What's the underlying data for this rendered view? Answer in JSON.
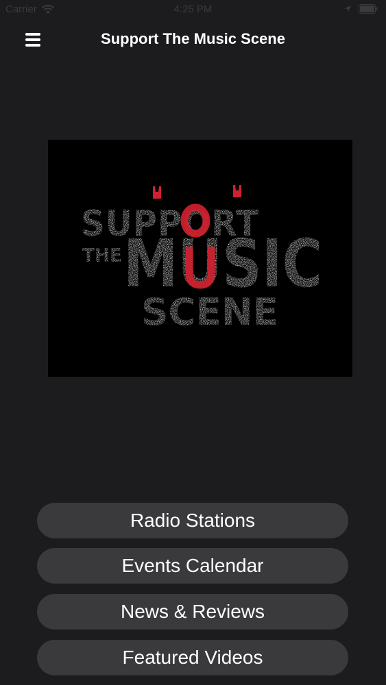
{
  "status_bar": {
    "carrier": "Carrier",
    "time": "4:25 PM"
  },
  "nav": {
    "title": "Support The Music Scene",
    "menu_icon": "hamburger-menu-icon"
  },
  "logo": {
    "line1": "SUPPORT",
    "line2_small": "THE",
    "line2_big": "MUSIC",
    "line3": "SCENE"
  },
  "menu_buttons": [
    {
      "label": "Radio Stations"
    },
    {
      "label": "Events Calendar"
    },
    {
      "label": "News & Reviews"
    },
    {
      "label": "Featured Videos"
    }
  ],
  "colors": {
    "background": "#1c1c1e",
    "button": "#3a3a3c",
    "logo_red": "#d0202e",
    "logo_text": "#e6e6e6"
  }
}
